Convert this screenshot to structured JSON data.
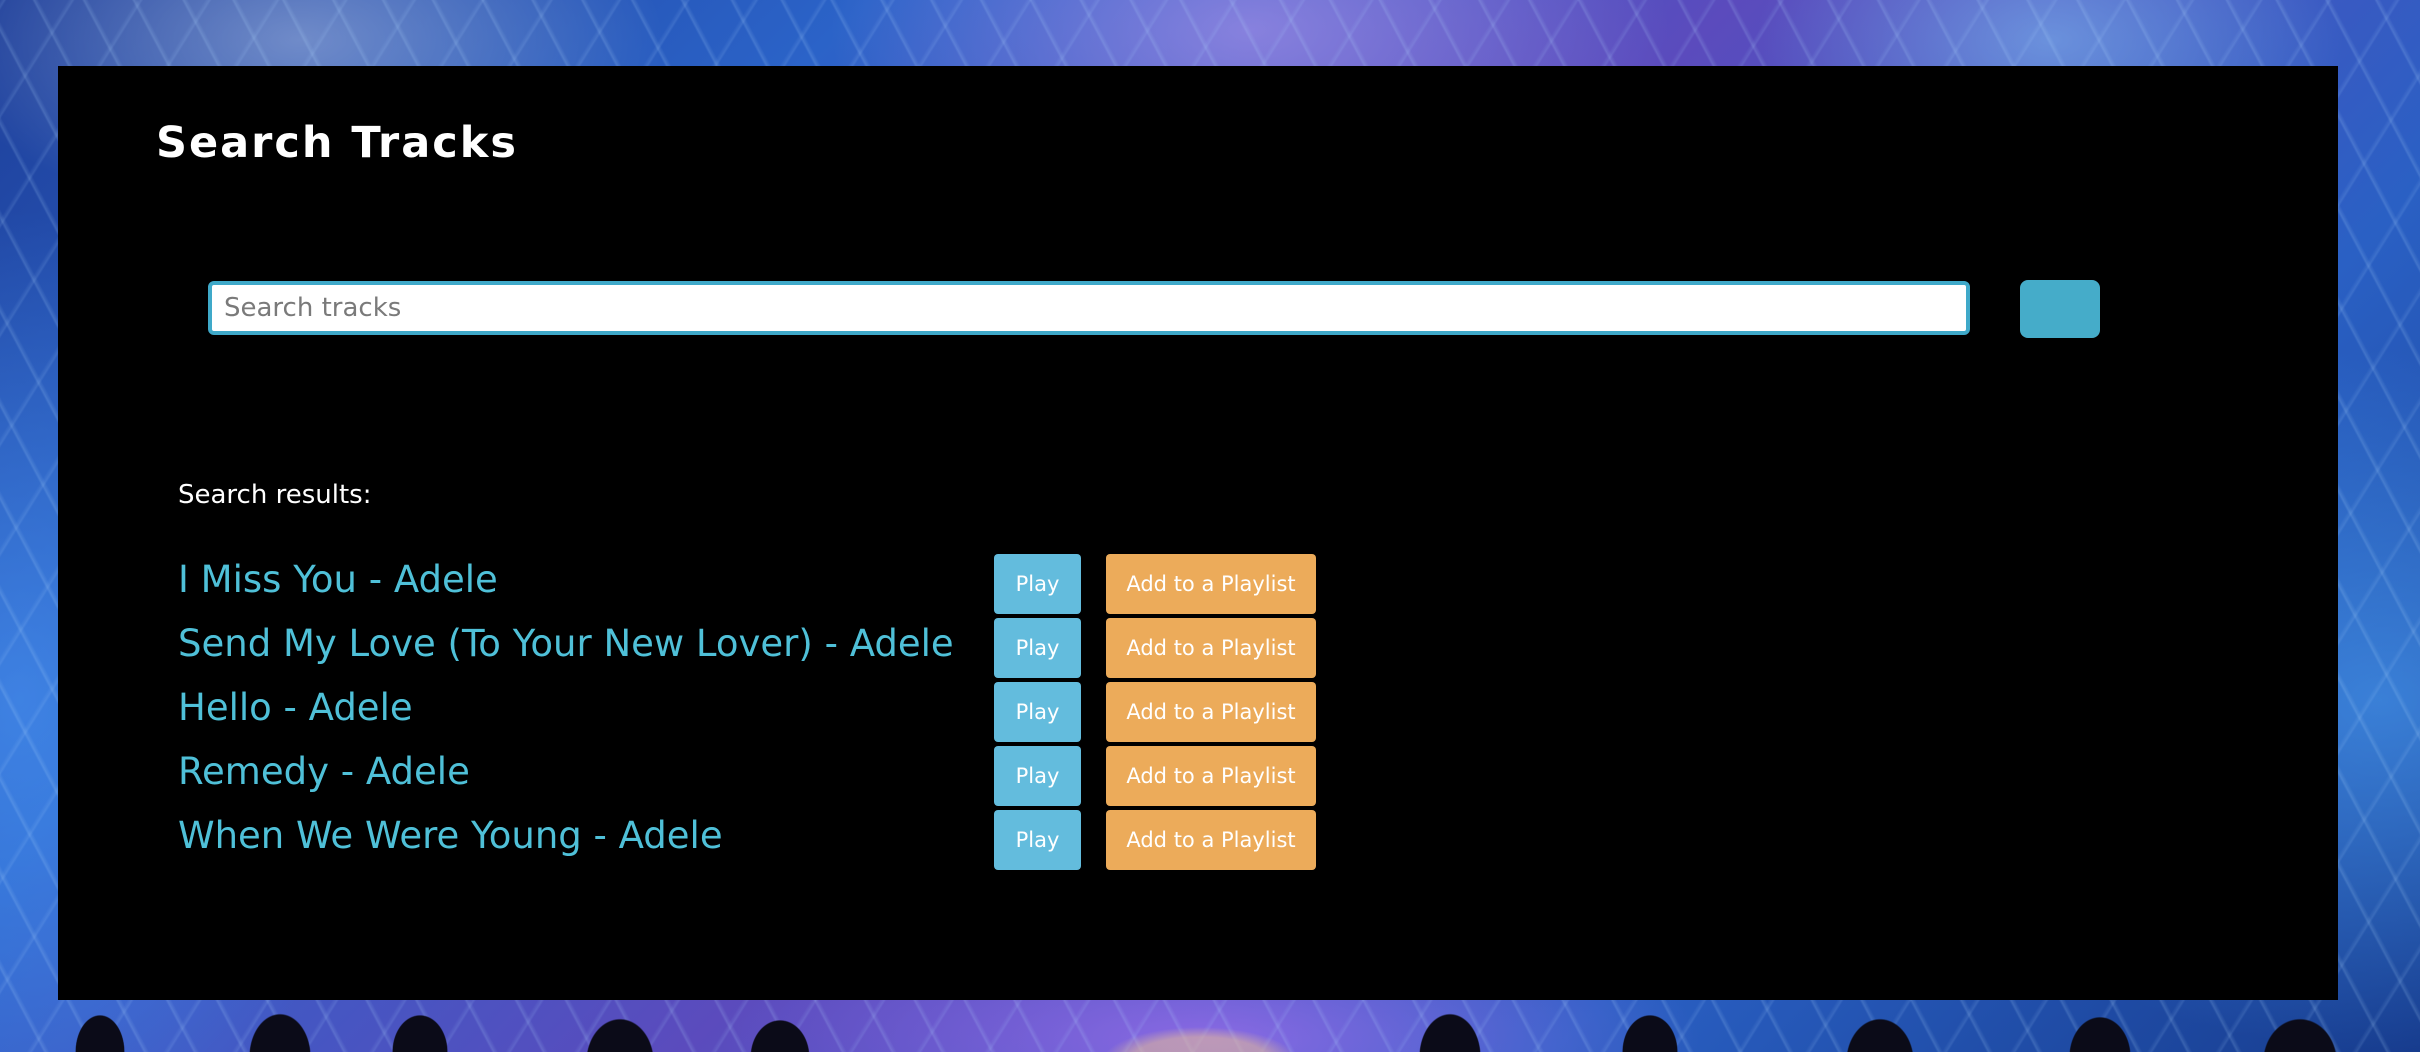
{
  "page": {
    "title": "Search Tracks"
  },
  "search": {
    "placeholder": "Search tracks",
    "value": "",
    "button_label": ""
  },
  "results": {
    "label": "Search results:",
    "play_label": "Play",
    "add_label": "Add to a Playlist",
    "items": [
      {
        "text": "I Miss You - Adele"
      },
      {
        "text": "Send My Love (To Your New Lover) - Adele"
      },
      {
        "text": "Hello - Adele"
      },
      {
        "text": "Remedy - Adele"
      },
      {
        "text": "When We Were Young - Adele"
      }
    ]
  },
  "colors": {
    "panel_background": "#000000",
    "accent_blue": "#45acc9",
    "track_link": "#4fc0d8",
    "play_button": "#63bcdd",
    "add_button": "#ecab5a"
  }
}
